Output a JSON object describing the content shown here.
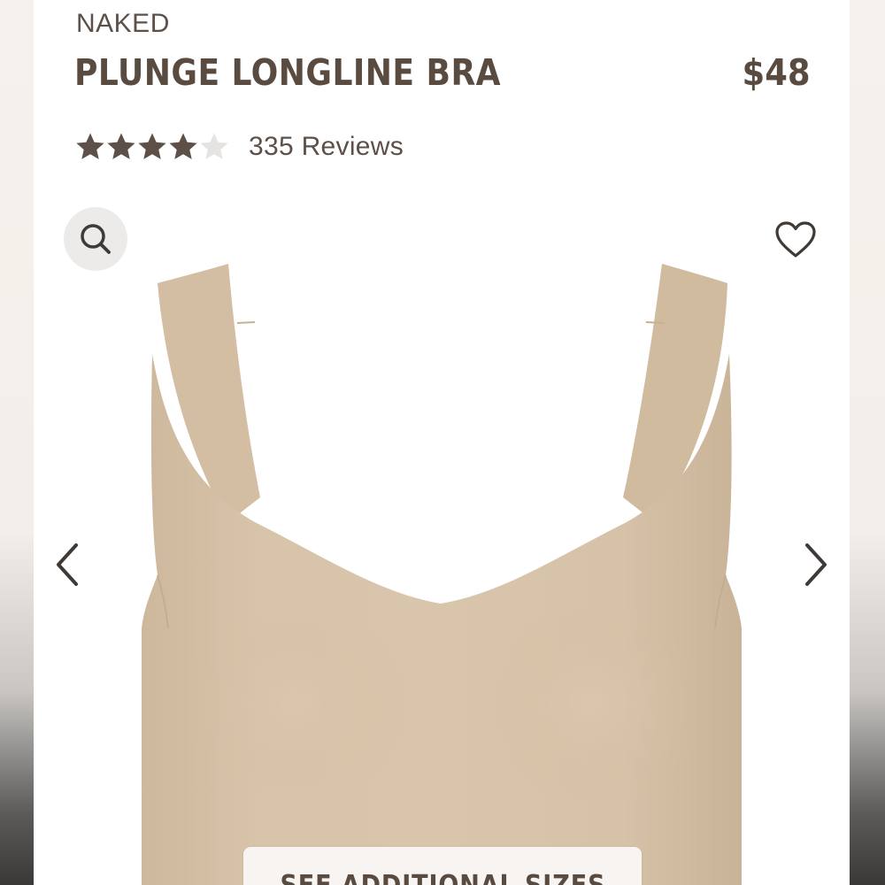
{
  "product": {
    "collection": "NAKED",
    "name": "PLUNGE LONGLINE BRA",
    "price": "$48",
    "rating": 4,
    "rating_max": 5,
    "reviews_label": "335 Reviews",
    "image_color": "#d6c2a8"
  },
  "actions": {
    "see_sizes_label": "SEE ADDITIONAL SIZES",
    "zoom_icon": "search-icon",
    "favorite_icon": "heart-icon",
    "prev_icon": "chevron-left-icon",
    "next_icon": "chevron-right-icon"
  },
  "colors": {
    "text": "#5a4b40",
    "star_filled": "#5c5048",
    "star_empty": "#e6e4e2",
    "button_bg": "#f7f4f1"
  }
}
